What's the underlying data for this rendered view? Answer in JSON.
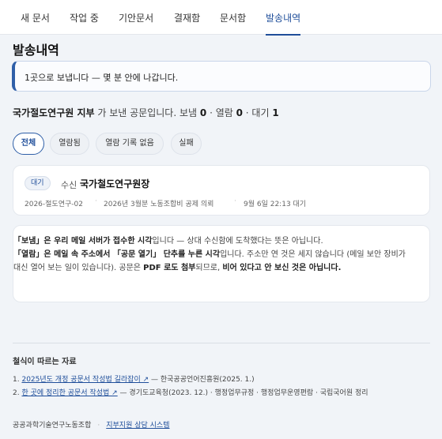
{
  "tabs": [
    {
      "label": "새 문서"
    },
    {
      "label": "작업 중"
    },
    {
      "label": "기안문서"
    },
    {
      "label": "결재함"
    },
    {
      "label": "문서함"
    },
    {
      "label": "발송내역"
    }
  ],
  "active_tab": "발송내역",
  "page_title": "발송내역",
  "notice": "1곳으로 보냅니다 — 몇 분 안에 나갑니다.",
  "sender": {
    "name": "국가절도연구원 지부",
    "suffix": "가 보낸 공문입니다. 보냄",
    "sent_count": "0",
    "sep1": "· 열람",
    "read_count": "0",
    "sep2": "· 대기",
    "wait_count": "1"
  },
  "filters": [
    {
      "label": "전체",
      "active": true
    },
    {
      "label": "열람됨",
      "active": false
    },
    {
      "label": "열람 기록 없음",
      "active": false
    },
    {
      "label": "실패",
      "active": false
    }
  ],
  "dispatch": {
    "status_badge": "대기",
    "recipient_label": "수신",
    "recipient_name": "국가철도연구원장",
    "doc_number": "2026-절도연구-02",
    "subject": "2026년 3월분 노동조합비 공제 의뢰",
    "time": "9월 6일 22:13 대기"
  },
  "explanation": {
    "p1_a": "「보냄」은 우리 메일 서버가 접수한 시각",
    "p1_b": "입니다 — 상대 수신함에 도착했다는 뜻은 아닙니다.",
    "p2_a": "「열람」은 메일 속 주소에서 「공문 열기」 단추를 누른 시각",
    "p2_b": "입니다. 주소만 연 것은 세지 않습니다 (메일 보안 장비가 대신 열어 보는 일이 있습니다). 공문은 ",
    "p2_c": "PDF 로도 첨부",
    "p2_d": "되므로, ",
    "p2_e": "비어 있다고 안 보신 것은 아닙니다."
  },
  "references": {
    "title": "철식이 따르는 자료",
    "items": [
      {
        "num": "1.",
        "link": "2025년도 개정 공문서 작성법 길라잡이 ↗",
        "rest": " — 한국공공언어진흥원(2025. 1.)"
      },
      {
        "num": "2.",
        "link": "한 곳에 정리한 공문서 작성법 ↗",
        "rest": " — 경기도교육청(2023. 12.) · 행정업무규정 · 행정업무운영편람 · 국립국어원 정리"
      }
    ]
  },
  "footer": {
    "org": "공공과학기술연구노동조합",
    "link": "지부지원 상담 시스템"
  }
}
